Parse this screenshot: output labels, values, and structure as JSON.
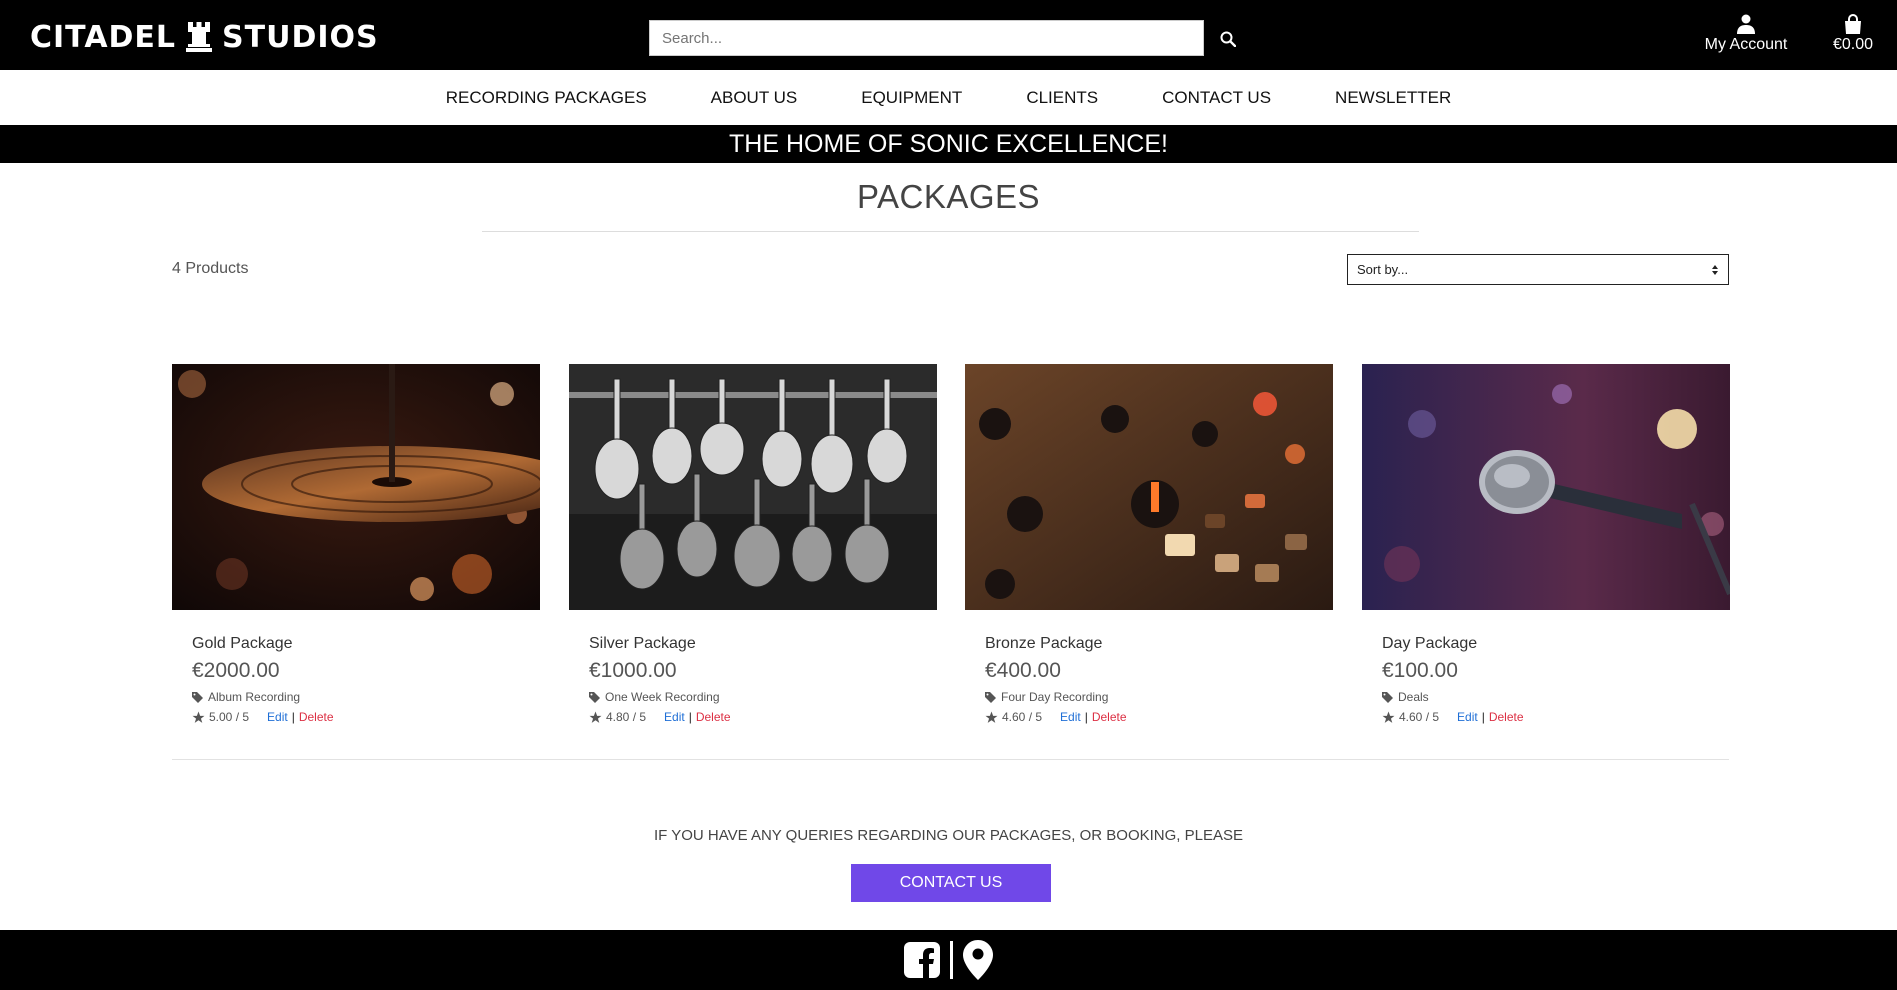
{
  "brand": {
    "name_left": "CITADEL",
    "name_right": "STUDIOS"
  },
  "search": {
    "placeholder": "Search..."
  },
  "account": {
    "label": "My Account"
  },
  "cart": {
    "total": "€0.00"
  },
  "nav": {
    "items": [
      {
        "label": "RECORDING PACKAGES"
      },
      {
        "label": "ABOUT US"
      },
      {
        "label": "EQUIPMENT"
      },
      {
        "label": "CLIENTS"
      },
      {
        "label": "CONTACT US"
      },
      {
        "label": "NEWSLETTER"
      }
    ]
  },
  "banner": {
    "text": "THE HOME OF SONIC EXCELLENCE!"
  },
  "page": {
    "title": "PACKAGES",
    "count": "4 Products",
    "sort_label": "Sort by..."
  },
  "products": [
    {
      "name": "Gold Package",
      "price": "€2000.00",
      "category": "Album Recording",
      "rating": "5.00 / 5",
      "edit": "Edit",
      "sep": "|",
      "delete": "Delete",
      "image": "cymbal-photo"
    },
    {
      "name": "Silver Package",
      "price": "€1000.00",
      "category": "One Week Recording",
      "rating": "4.80 / 5",
      "edit": "Edit",
      "sep": "|",
      "delete": "Delete",
      "image": "guitars-photo"
    },
    {
      "name": "Bronze Package",
      "price": "€400.00",
      "category": "Four Day Recording",
      "rating": "4.60 / 5",
      "edit": "Edit",
      "sep": "|",
      "delete": "Delete",
      "image": "mixer-photo"
    },
    {
      "name": "Day Package",
      "price": "€100.00",
      "category": "Deals",
      "rating": "4.60 / 5",
      "edit": "Edit",
      "sep": "|",
      "delete": "Delete",
      "image": "microphone-photo"
    }
  ],
  "query": {
    "text": "IF YOU HAVE ANY QUERIES REGARDING OUR PACKAGES, OR BOOKING, PLEASE",
    "button": "CONTACT US"
  },
  "colors": {
    "accent": "#7048e8",
    "edit": "#1f6fd6",
    "delete": "#dc2f43",
    "header": "#000000"
  }
}
